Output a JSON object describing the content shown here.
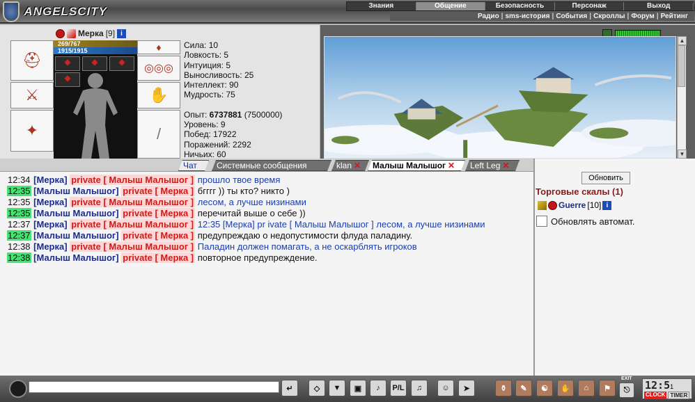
{
  "app": {
    "logo_text": "ANGELSCITY"
  },
  "main_nav": [
    {
      "label": "Знания"
    },
    {
      "label": "Общение"
    },
    {
      "label": "Безопасность"
    },
    {
      "label": "Персонаж"
    },
    {
      "label": "Выход"
    }
  ],
  "sub_nav": [
    {
      "label": "Радио"
    },
    {
      "label": "sms-история"
    },
    {
      "label": "События"
    },
    {
      "label": "Скроллы"
    },
    {
      "label": "Форум"
    },
    {
      "label": "Рейтинг"
    }
  ],
  "character": {
    "name": "Мерка",
    "level": "[9]",
    "hp": "269/767",
    "mp": "1915/1915",
    "stats": {
      "strength": "Сила: 10",
      "agility": "Ловкость: 5",
      "intuition": "Интуиция: 5",
      "endurance": "Выносливость: 25",
      "intellect": "Интеллект: 90",
      "wisdom": "Мудрость: 75"
    },
    "experience_label": "Опыт:",
    "experience_value": "6737881",
    "experience_next": "(7500000)",
    "level_line": "Уровень: 9",
    "wins": "Побед: 17922",
    "losses": "Поражений: 2292",
    "draws": "Ничьих: 60"
  },
  "tabs": [
    {
      "label": "Чат"
    },
    {
      "label": "Системные сообщения"
    },
    {
      "label": "klan"
    },
    {
      "label": "Малыш Малышог"
    },
    {
      "label": "Left Leg"
    }
  ],
  "chat": [
    {
      "time": "12:34",
      "sender": "[Мерка]",
      "private": "private [ Малыш Малышог ]",
      "text": "прошло твое время"
    },
    {
      "time": "12:35",
      "sender": "[Малыш Малышог]",
      "private": "private [ Мерка ]",
      "text": "бгггг )) ты кто? никто )"
    },
    {
      "time": "12:35",
      "sender": "[Мерка]",
      "private": "private [ Малыш Малышог ]",
      "text": "лесом, а лучше низинами"
    },
    {
      "time": "12:35",
      "sender": "[Малыш Малышог]",
      "private": "private [ Мерка ]",
      "text": "перечитай выше о себе ))"
    },
    {
      "time": "12:37",
      "sender": "[Мерка]",
      "private": "private [ Малыш Малышог ]",
      "text": "12:35 [Мерка] pr ivate [ Малыш Малышог ] лесом, а лучше низинами"
    },
    {
      "time": "12:37",
      "sender": "[Малыш Малышог]",
      "private": "private [ Мерка ]",
      "text": "предупреждаю о недопустимости флуда паладину."
    },
    {
      "time": "12:38",
      "sender": "[Мерка]",
      "private": "private [ Малыш Малышог ]",
      "text": "Паладин должен помагать, а не оскарблять игроков"
    },
    {
      "time": "12:38",
      "sender": "[Малыш Малышог]",
      "private": "private [ Мерка ]",
      "text": "повторное предупреждение."
    }
  ],
  "right_panel": {
    "refresh_label": "Обновить",
    "room_title": "Торговые скалы (1)",
    "user_name": "Guerre",
    "user_level": "[10]",
    "auto_refresh_label": "Обновлять автомат."
  },
  "bottom": {
    "chat_input_value": "",
    "clock_time": "12:5",
    "clock_seconds": "1",
    "clock_label": "CLOCK",
    "timer_label": "TIMER",
    "exit_label": "EXIT",
    "filter_label": "P/L"
  }
}
